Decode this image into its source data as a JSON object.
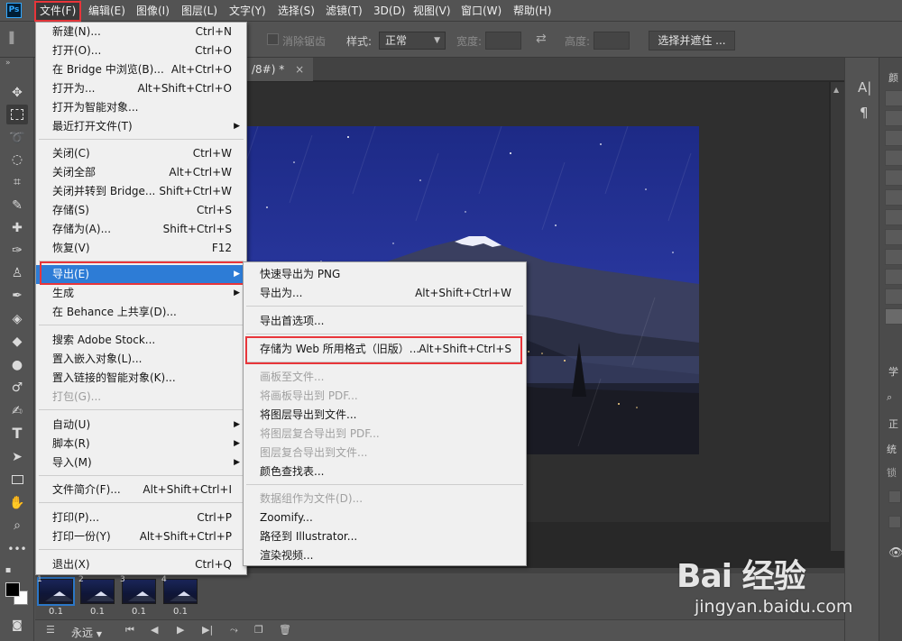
{
  "app": {
    "logo": "Ps"
  },
  "menubar": {
    "items": [
      "文件(F)",
      "编辑(E)",
      "图像(I)",
      "图层(L)",
      "文字(Y)",
      "选择(S)",
      "滤镜(T)",
      "3D(D)",
      "视图(V)",
      "窗口(W)",
      "帮助(H)"
    ],
    "active": "文件(F)"
  },
  "options_bar": {
    "antialias_label": "消除锯齿",
    "style_label": "样式:",
    "style_value": "正常",
    "width_label": "宽度:",
    "height_label": "高度:",
    "select_mask_button": "选择并遮住 ..."
  },
  "document": {
    "tab_title": "/8#) *",
    "tab_close": "×"
  },
  "file_menu": {
    "items": [
      {
        "label": "新建(N)...",
        "shortcut": "Ctrl+N"
      },
      {
        "label": "打开(O)...",
        "shortcut": "Ctrl+O"
      },
      {
        "label": "在 Bridge 中浏览(B)...",
        "shortcut": "Alt+Ctrl+O"
      },
      {
        "label": "打开为...",
        "shortcut": "Alt+Shift+Ctrl+O"
      },
      {
        "label": "打开为智能对象...",
        "shortcut": ""
      },
      {
        "label": "最近打开文件(T)",
        "shortcut": "",
        "submenu": true
      },
      {
        "label": "关闭(C)",
        "shortcut": "Ctrl+W"
      },
      {
        "label": "关闭全部",
        "shortcut": "Alt+Ctrl+W"
      },
      {
        "label": "关闭并转到 Bridge...",
        "shortcut": "Shift+Ctrl+W"
      },
      {
        "label": "存储(S)",
        "shortcut": "Ctrl+S"
      },
      {
        "label": "存储为(A)...",
        "shortcut": "Shift+Ctrl+S"
      },
      {
        "label": "恢复(V)",
        "shortcut": "F12"
      },
      {
        "label": "导出(E)",
        "shortcut": "",
        "submenu": true,
        "highlighted": true
      },
      {
        "label": "生成",
        "shortcut": "",
        "submenu": true
      },
      {
        "label": "在 Behance 上共享(D)...",
        "shortcut": ""
      },
      {
        "label": "搜索 Adobe Stock...",
        "shortcut": ""
      },
      {
        "label": "置入嵌入对象(L)...",
        "shortcut": ""
      },
      {
        "label": "置入链接的智能对象(K)...",
        "shortcut": ""
      },
      {
        "label": "打包(G)...",
        "shortcut": "",
        "disabled": true
      },
      {
        "label": "自动(U)",
        "shortcut": "",
        "submenu": true
      },
      {
        "label": "脚本(R)",
        "shortcut": "",
        "submenu": true
      },
      {
        "label": "导入(M)",
        "shortcut": "",
        "submenu": true
      },
      {
        "label": "文件简介(F)...",
        "shortcut": "Alt+Shift+Ctrl+I"
      },
      {
        "label": "打印(P)...",
        "shortcut": "Ctrl+P"
      },
      {
        "label": "打印一份(Y)",
        "shortcut": "Alt+Shift+Ctrl+P"
      },
      {
        "label": "退出(X)",
        "shortcut": "Ctrl+Q"
      }
    ]
  },
  "export_submenu": {
    "items": [
      {
        "label": "快速导出为 PNG",
        "shortcut": ""
      },
      {
        "label": "导出为...",
        "shortcut": "Alt+Shift+Ctrl+W"
      },
      {
        "label": "导出首选项...",
        "shortcut": ""
      },
      {
        "label": "存储为 Web 所用格式（旧版）...",
        "shortcut": "Alt+Shift+Ctrl+S",
        "highlighted": true
      },
      {
        "label": "画板至文件...",
        "shortcut": "",
        "disabled": true
      },
      {
        "label": "将画板导出到 PDF...",
        "shortcut": "",
        "disabled": true
      },
      {
        "label": "将图层导出到文件...",
        "shortcut": ""
      },
      {
        "label": "将图层复合导出到 PDF...",
        "shortcut": "",
        "disabled": true
      },
      {
        "label": "图层复合导出到文件...",
        "shortcut": "",
        "disabled": true
      },
      {
        "label": "颜色查找表...",
        "shortcut": ""
      },
      {
        "label": "数据组作为文件(D)...",
        "shortcut": "",
        "disabled": true
      },
      {
        "label": "Zoomify...",
        "shortcut": ""
      },
      {
        "label": "路径到 Illustrator...",
        "shortcut": ""
      },
      {
        "label": "渲染视频...",
        "shortcut": ""
      }
    ]
  },
  "timeline": {
    "frames": [
      {
        "number": "1",
        "delay": "0.1"
      },
      {
        "number": "2",
        "delay": "0.1"
      },
      {
        "number": "3",
        "delay": "0.1"
      },
      {
        "number": "4",
        "delay": "0.1"
      }
    ],
    "loop_label": "永远"
  },
  "right_panel": {
    "tab_color": "颜",
    "tab_learn": "学",
    "label_uniform": "统",
    "label_lock": "锁",
    "label_zheng": "正"
  },
  "watermark": {
    "brand": "Bai 经验",
    "url": "jingyan.baidu.com"
  },
  "colors": {
    "accent": "#2d7cd6",
    "highlight_box": "#e8353a",
    "menu_bg": "#f0f0f0",
    "ui_bg": "#535353"
  }
}
